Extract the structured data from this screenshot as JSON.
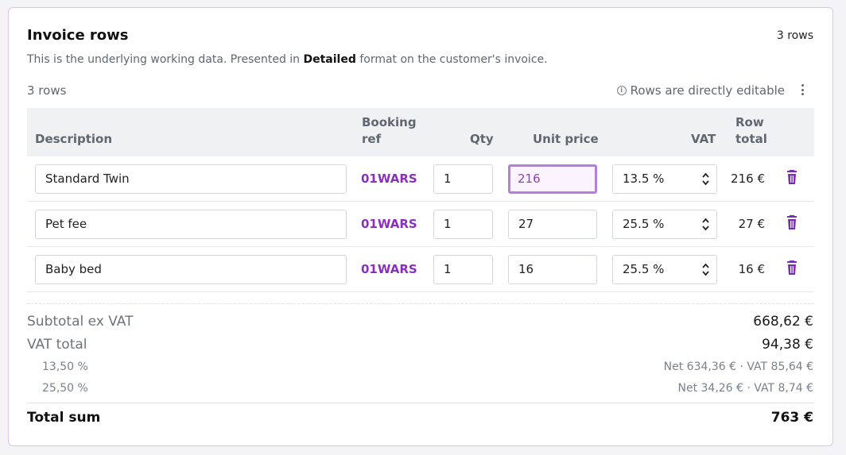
{
  "header": {
    "title": "Invoice rows",
    "rows_count": "3 rows",
    "subtitle_before": "This is the underlying working data. Presented in ",
    "subtitle_bold": "Detailed",
    "subtitle_after": " format on the customer's invoice."
  },
  "toolbar": {
    "rows_label": "3 rows",
    "editable_note": "Rows are directly editable",
    "info_icon": "i"
  },
  "table": {
    "columns": {
      "description": "Description",
      "booking_ref_line1": "Booking",
      "booking_ref_line2": "ref",
      "qty": "Qty",
      "unit_price": "Unit price",
      "vat": "VAT",
      "row_total_line1": "Row",
      "row_total_line2": "total"
    },
    "rows": [
      {
        "description": "Standard Twin",
        "booking_ref": "01WARS",
        "qty": "1",
        "unit_price": "216",
        "vat": "13.5 %",
        "row_total": "216 €"
      },
      {
        "description": "Pet fee",
        "booking_ref": "01WARS",
        "qty": "1",
        "unit_price": "27",
        "vat": "25.5 %",
        "row_total": "27 €"
      },
      {
        "description": "Baby bed",
        "booking_ref": "01WARS",
        "qty": "1",
        "unit_price": "16",
        "vat": "25.5 %",
        "row_total": "16 €"
      }
    ]
  },
  "summary": {
    "subtotal_label": "Subtotal ex VAT",
    "subtotal_value": "668,62 €",
    "vat_total_label": "VAT total",
    "vat_total_value": "94,38 €",
    "vat_breakdown": [
      {
        "rate": "13,50 %",
        "detail": "Net 634,36 € · VAT 85,64 €"
      },
      {
        "rate": "25,50 %",
        "detail": "Net 34,26 € · VAT 8,74 €"
      }
    ],
    "total_label": "Total sum",
    "total_value": "763 €"
  },
  "colors": {
    "accent": "#8a2fc0",
    "trash": "#7c2bb5",
    "focus_border": "#b47de0"
  }
}
